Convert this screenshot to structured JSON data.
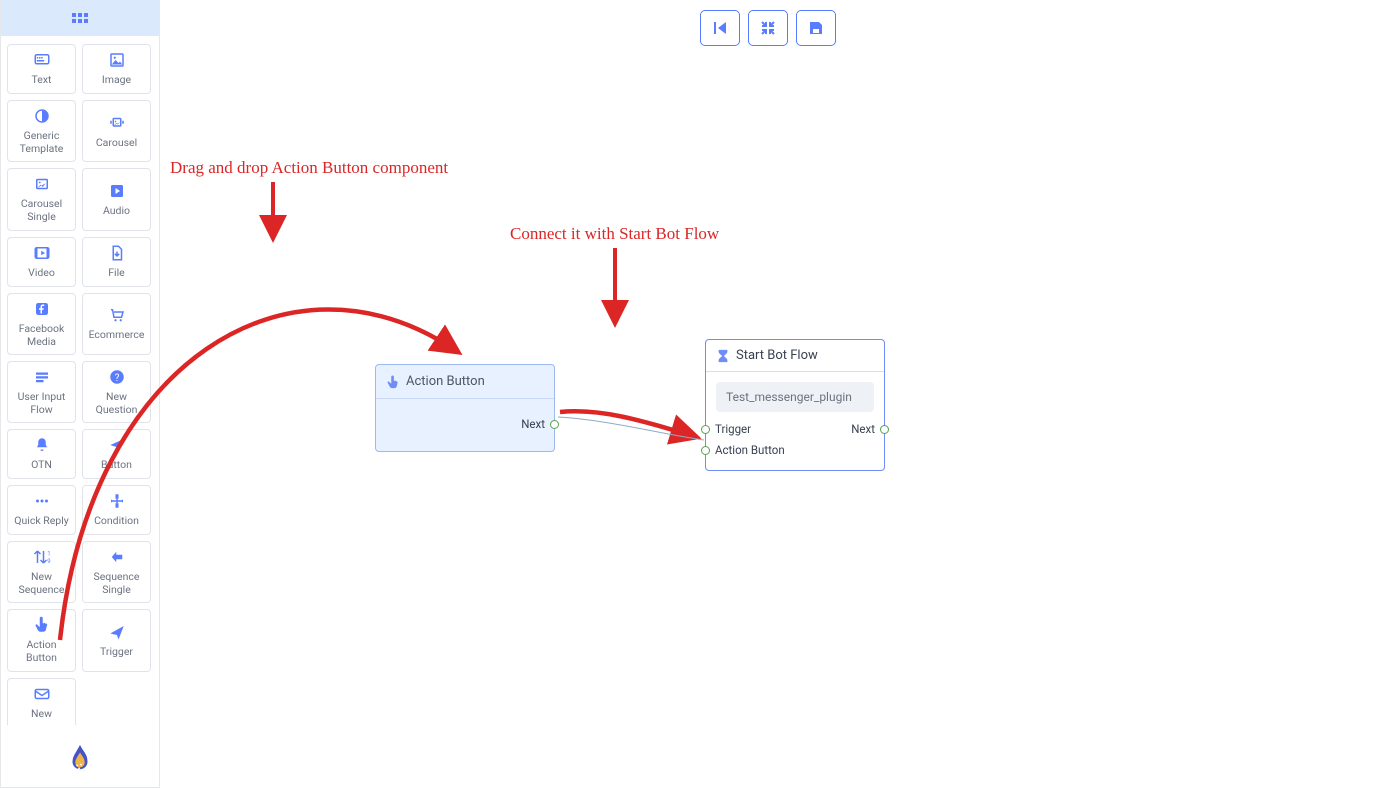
{
  "sidebar": {
    "items": [
      {
        "id": "text",
        "label": "Text"
      },
      {
        "id": "image",
        "label": "Image"
      },
      {
        "id": "generic-template",
        "label": "Generic Template"
      },
      {
        "id": "carousel",
        "label": "Carousel"
      },
      {
        "id": "carousel-single",
        "label": "Carousel Single"
      },
      {
        "id": "audio",
        "label": "Audio"
      },
      {
        "id": "video",
        "label": "Video"
      },
      {
        "id": "file",
        "label": "File"
      },
      {
        "id": "facebook-media",
        "label": "Facebook Media"
      },
      {
        "id": "ecommerce",
        "label": "Ecommerce"
      },
      {
        "id": "user-input-flow",
        "label": "User Input Flow"
      },
      {
        "id": "new-question",
        "label": "New Question"
      },
      {
        "id": "otn",
        "label": "OTN"
      },
      {
        "id": "button",
        "label": "Button"
      },
      {
        "id": "quick-reply",
        "label": "Quick Reply"
      },
      {
        "id": "condition",
        "label": "Condition"
      },
      {
        "id": "new-sequence",
        "label": "New Sequence"
      },
      {
        "id": "sequence-single",
        "label": "Sequence Single"
      },
      {
        "id": "action-button",
        "label": "Action Button"
      },
      {
        "id": "trigger",
        "label": "Trigger"
      },
      {
        "id": "new",
        "label": "New"
      }
    ]
  },
  "annotations": {
    "drag": "Drag and drop Action Button component",
    "connect": "Connect it with Start Bot Flow"
  },
  "nodes": {
    "action": {
      "title": "Action Button",
      "port_out": "Next"
    },
    "start": {
      "title": "Start Bot Flow",
      "reference": "Test_messenger_plugin",
      "port_in_trigger": "Trigger",
      "port_in_action": "Action Button",
      "port_out_next": "Next"
    }
  }
}
